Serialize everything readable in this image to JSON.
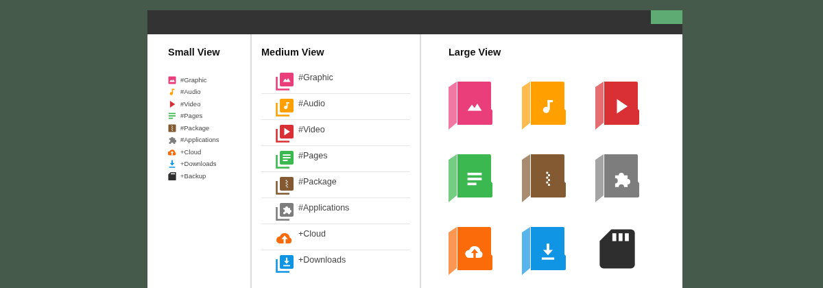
{
  "small_view": {
    "title": "Small View",
    "items": [
      {
        "label": "#Graphic",
        "kind": "graphic",
        "color": "#e93e7a"
      },
      {
        "label": "#Audio",
        "kind": "audio",
        "color": "#ffa000"
      },
      {
        "label": "#Video",
        "kind": "video",
        "color": "#d93035"
      },
      {
        "label": "#Pages",
        "kind": "pages",
        "color": "#3bb84f"
      },
      {
        "label": "#Package",
        "kind": "package",
        "color": "#845a32"
      },
      {
        "label": "#Applications",
        "kind": "applications",
        "color": "#7d7d7d"
      },
      {
        "label": "+Cloud",
        "kind": "cloud",
        "color": "#fb6b0a"
      },
      {
        "label": "+Downloads",
        "kind": "downloads",
        "color": "#0f95e4"
      },
      {
        "label": "+Backup",
        "kind": "backup",
        "color": "#2e2e2e"
      }
    ]
  },
  "medium_view": {
    "title": "Medium View",
    "items": [
      {
        "label": "#Graphic",
        "kind": "graphic",
        "color": "#e93e7a"
      },
      {
        "label": "#Audio",
        "kind": "audio",
        "color": "#ffa000"
      },
      {
        "label": "#Video",
        "kind": "video",
        "color": "#d93035"
      },
      {
        "label": "#Pages",
        "kind": "pages",
        "color": "#3bb84f"
      },
      {
        "label": "#Package",
        "kind": "package",
        "color": "#845a32"
      },
      {
        "label": "#Applications",
        "kind": "applications",
        "color": "#7d7d7d"
      },
      {
        "label": "+Cloud",
        "kind": "cloud",
        "color": "#fb6b0a"
      },
      {
        "label": "+Downloads",
        "kind": "downloads",
        "color": "#0f95e4"
      }
    ]
  },
  "large_view": {
    "title": "Large View",
    "items": [
      {
        "kind": "graphic",
        "color": "#e93e7a"
      },
      {
        "kind": "audio",
        "color": "#ffa000"
      },
      {
        "kind": "video",
        "color": "#d93035"
      },
      {
        "kind": "pages",
        "color": "#3bb84f"
      },
      {
        "kind": "package",
        "color": "#845a32"
      },
      {
        "kind": "applications",
        "color": "#7d7d7d"
      },
      {
        "kind": "cloud",
        "color": "#fb6b0a"
      },
      {
        "kind": "downloads",
        "color": "#0f95e4"
      },
      {
        "kind": "backup",
        "color": "#2e2e2e"
      }
    ]
  }
}
